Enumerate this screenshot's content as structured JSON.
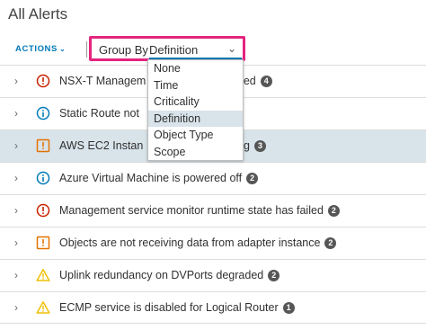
{
  "page": {
    "title": "All Alerts"
  },
  "toolbar": {
    "actions_label": "ACTIONS",
    "group_by_label": "Group By",
    "group_by_value": "Definition"
  },
  "group_by_options": [
    "None",
    "Time",
    "Criticality",
    "Definition",
    "Object Type",
    "Scope"
  ],
  "alerts": [
    {
      "text": "NSX-T Managem",
      "text_after": "ailed",
      "count": "4",
      "icon": "critical-icon"
    },
    {
      "text": "Static Route not",
      "text_after": "",
      "count": "",
      "icon": "info-icon"
    },
    {
      "text": "AWS EC2 Instan",
      "text_after": "ning",
      "count": "3",
      "icon": "immediate-icon"
    },
    {
      "text": "Azure Virtual Machine is powered off",
      "count": "2",
      "icon": "info-icon"
    },
    {
      "text": "Management service monitor runtime state has failed",
      "count": "2",
      "icon": "critical-icon"
    },
    {
      "text": "Objects are not receiving data from adapter instance",
      "count": "2",
      "icon": "immediate-icon"
    },
    {
      "text": "Uplink redundancy on DVPorts degraded",
      "count": "2",
      "icon": "warning-icon"
    },
    {
      "text": "ECMP service is disabled for Logical Router",
      "count": "1",
      "icon": "warning-icon"
    }
  ],
  "colors": {
    "accent": "#0079b8",
    "highlight_border": "#e4247f",
    "critical": "#c92100",
    "immediate": "#e57200",
    "warning": "#efc006",
    "info": "#0079b8",
    "selected_row": "#d8e3ea"
  }
}
